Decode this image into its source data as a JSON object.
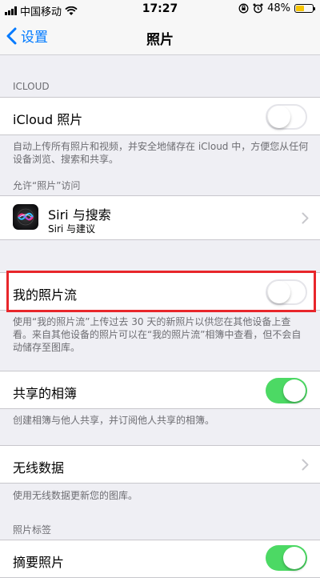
{
  "status_bar": {
    "carrier": "中国移动",
    "time": "17:27",
    "battery_percent": "48%",
    "battery_level": 0.48,
    "icons": [
      "signal-icon",
      "wifi-icon",
      "orientation-lock-icon",
      "alarm-icon",
      "battery-icon"
    ]
  },
  "nav": {
    "back_label": "设置",
    "title": "照片"
  },
  "sections": {
    "icloud_header": "ICLOUD",
    "icloud_photos_label": "iCloud 照片",
    "icloud_photos_on": false,
    "icloud_footer": "自动上传所有照片和视频，并安全地储存在 iCloud 中，方便您从任何设备浏览、搜索和共享。",
    "access_header": "允许“照片”访问",
    "siri_title": "Siri 与搜索",
    "siri_subtitle": "Siri 与建议",
    "photostream_label": "我的照片流",
    "photostream_on": false,
    "photostream_footer": "使用“我的照片流”上传过去 30 天的新照片以供您在其他设备上查看。来自其他设备的照片可以在“我的照片流”相簿中查看，但不会自动储存至图库。",
    "shared_albums_label": "共享的相簿",
    "shared_albums_on": true,
    "shared_albums_footer": "创建相簿与他人共享，并订阅他人共享的相簿。",
    "wireless_label": "无线数据",
    "wireless_footer": "使用无线数据更新您的图库。",
    "tabs_header": "照片标签",
    "summary_label": "摘要照片",
    "summary_on": true
  },
  "colors": {
    "accent": "#007aff",
    "toggle_on": "#4cd964",
    "highlight": "#e8262b"
  }
}
